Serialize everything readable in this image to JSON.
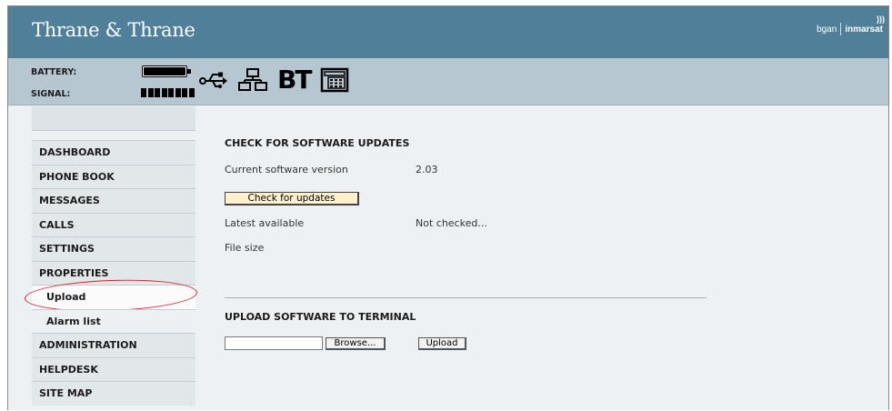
{
  "header": {
    "brand": "Thrane & Thrane",
    "partner_left": "bgan",
    "partner_right": "inmarsat"
  },
  "status": {
    "battery_label": "BATTERY:",
    "signal_label": "SIGNAL:",
    "battery_level": 1.0,
    "signal_bars": 8,
    "connection_icons": [
      "usb-icon",
      "lan-icon",
      "bluetooth-icon",
      "phone-icon"
    ],
    "bt_text": "BT"
  },
  "sidebar": {
    "items": [
      {
        "label": "DASHBOARD",
        "type": "main"
      },
      {
        "label": "PHONE BOOK",
        "type": "main"
      },
      {
        "label": "MESSAGES",
        "type": "main"
      },
      {
        "label": "CALLS",
        "type": "main"
      },
      {
        "label": "SETTINGS",
        "type": "main"
      },
      {
        "label": "PROPERTIES",
        "type": "main"
      },
      {
        "label": "Upload",
        "type": "sub",
        "active": true
      },
      {
        "label": "Alarm list",
        "type": "sub"
      },
      {
        "label": "ADMINISTRATION",
        "type": "main"
      },
      {
        "label": "HELPDESK",
        "type": "main"
      },
      {
        "label": "SITE MAP",
        "type": "main"
      }
    ]
  },
  "main": {
    "check_title": "CHECK FOR SOFTWARE UPDATES",
    "current_version_label": "Current software version",
    "current_version_value": "2.03",
    "check_button": "Check for updates",
    "latest_label": "Latest available",
    "latest_value": "Not checked...",
    "file_size_label": "File size",
    "upload_title": "UPLOAD SOFTWARE TO TERMINAL",
    "file_input_value": "",
    "browse_button": "Browse...",
    "upload_button": "Upload"
  },
  "colors": {
    "header_bg": "#507f99",
    "status_bg": "#b7c7d2",
    "check_button_bg": "#fff1cc",
    "highlight_ring": "#d4252a"
  }
}
